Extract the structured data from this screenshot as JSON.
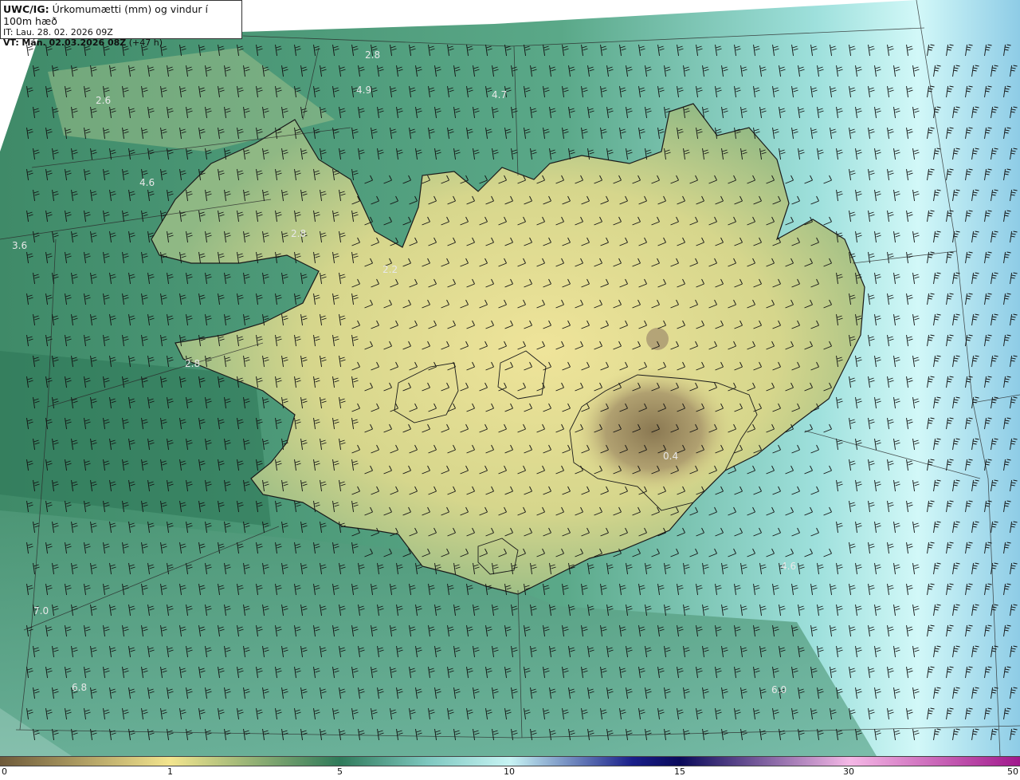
{
  "header": {
    "model": "UWC/IG:",
    "title": "Úrkomumætti (mm) og vindur í 100m hæð",
    "it_label": "IT:",
    "it_value": "Lau. 28. 02. 2026 09Z",
    "vt_label": "VT:",
    "vt_value": "Mán. 02.03.2026 08Z",
    "lead": "(+47 h)"
  },
  "value_labels": [
    "2.8",
    "4.9",
    "4.7",
    "2.6",
    "4.6",
    "3.6",
    "2.8",
    "2.2",
    "2.8",
    "0.4",
    "4.6",
    "7.0",
    "6.8",
    "6.0"
  ],
  "colorbar": {
    "ticks": [
      "0",
      "1",
      "5",
      "10",
      "15",
      "30",
      "50"
    ],
    "colors": {
      "brown": "#6e5a3a",
      "yellow": "#f3e58e",
      "green": "#2f7a5a",
      "teal": "#7fc8c0",
      "cyan": "#c8f4f4",
      "blue": "#1a1f8a",
      "navy": "#0a0a5a",
      "pink": "#f5b8e6",
      "magenta": "#a0188c"
    }
  },
  "map_colors": {
    "sea_green": "#3f8a68",
    "land_yellow": "#d8d88a",
    "dry_brown": "#9a8a5c",
    "east_cyan": "#bfeff0",
    "coast": "#1a1a1a",
    "barb": "#111111"
  }
}
